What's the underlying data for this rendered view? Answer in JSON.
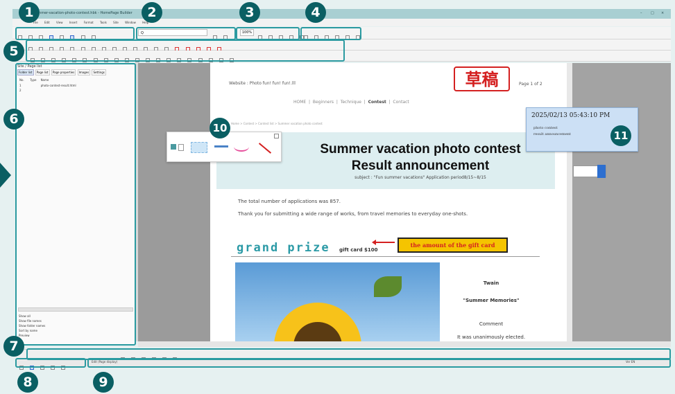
{
  "window": {
    "title": "Summer-vacation-photo-contest.hbk - HomePage Builder",
    "controls": [
      "–",
      "□",
      "×"
    ]
  },
  "menubar": [
    "File",
    "Edit",
    "View",
    "Insert",
    "Format",
    "Tools",
    "Site",
    "Window",
    "Help"
  ],
  "toolbar": {
    "search_placeholder": "Q",
    "zoom": "100%"
  },
  "left_panel": {
    "title": "Site / Page list",
    "tabs": [
      "Folder list",
      "Page list",
      "Page properties",
      "Images",
      "Settings"
    ],
    "columns": [
      "No.",
      "Type",
      "Name"
    ],
    "rows": [
      {
        "no": "1",
        "type": "",
        "name": "photo-contest-result.html"
      },
      {
        "no": "2",
        "type": "",
        "name": ""
      }
    ],
    "options": [
      "Show all",
      "Show file names",
      "Show folder names",
      "Sort by name",
      "Preview"
    ]
  },
  "document": {
    "site_title": "Website : Photo fun! fun! fun!.lll",
    "stamp": "草稿",
    "page_info": "Page 1 of 2",
    "nav": [
      "HOME",
      "Beginners",
      "Technique",
      "Contest",
      "Contact"
    ],
    "breadcrumb": "Home  >  Contest  >  Contest list  >  Summer vacation photo contest",
    "heading_line1": "Summer vacation photo contest",
    "heading_line2": "Result announcement",
    "subject": "subject : \"Fun summer vacations\" Application period8/15~8/15",
    "para1": "The total number of applications was 857.",
    "para2": "Thank you for submitting a wide range of works, from travel memories to everyday one-shots.",
    "grand_prize": "grand prize",
    "gift_card": "gift card $100",
    "amount_label": "the amount of the gift card",
    "winner_name": "Twain",
    "winner_title": "\"Summer Memories\"",
    "comment_label": "Comment",
    "comment_text": "It was unanimously elected."
  },
  "sticky_note": {
    "timestamp": "2025/02/13 05:43:10 PM",
    "line1": "photo contest",
    "line2": "result announcement"
  },
  "statusbar": {
    "status_text": "Edit (Page display)",
    "right_info": "Ver  EN"
  },
  "callouts": [
    "1",
    "2",
    "3",
    "4",
    "5",
    "6",
    "7",
    "8",
    "9",
    "10",
    "11"
  ],
  "colors": {
    "accent": "#0a5f63",
    "frame": "#2a9aa0",
    "heading_bg": "#ddeef0",
    "grand_prize": "#2b9aa6",
    "amount_bg": "#f5c400",
    "stamp_red": "#d42020",
    "note_bg": "#cce0f5"
  }
}
